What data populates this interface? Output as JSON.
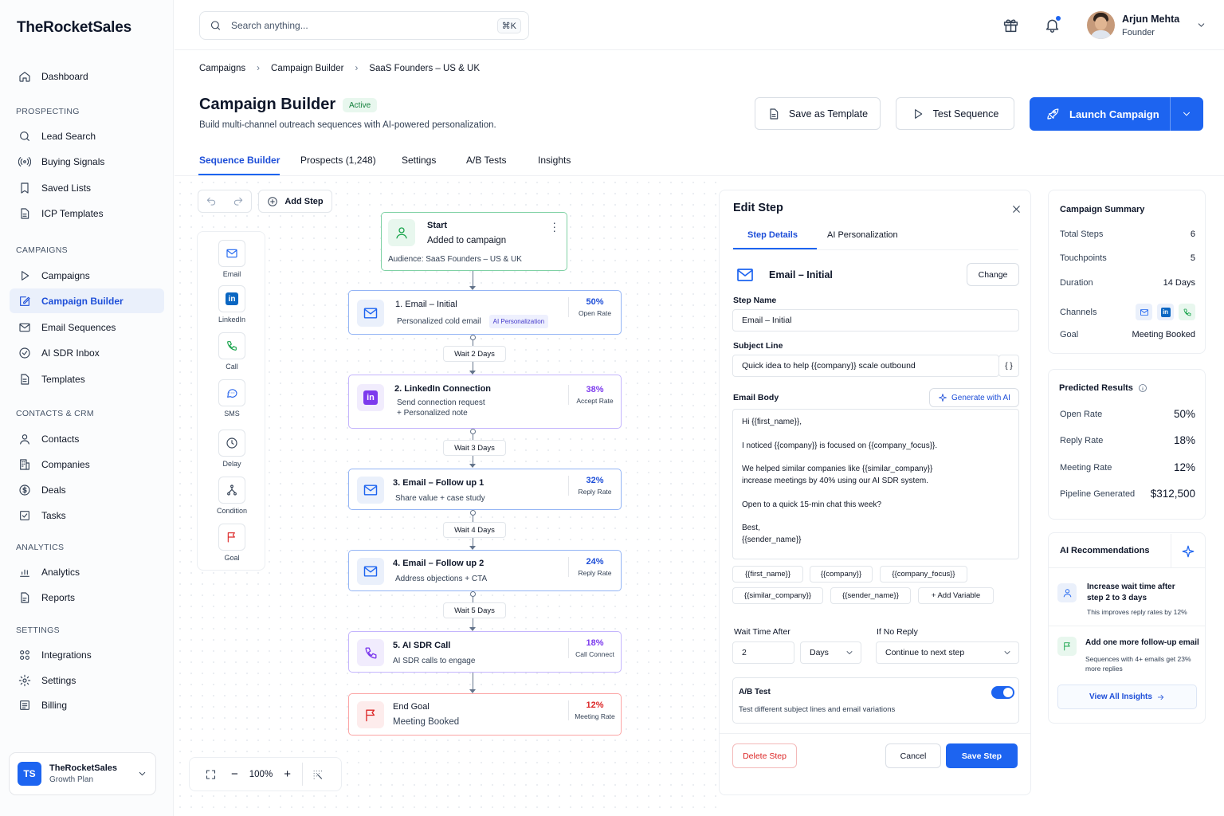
{
  "brand": "TheRocketSales",
  "sidebar": {
    "dashboard": "Dashboard",
    "sec_prospecting": "PROSPECTING",
    "lead_search": "Lead Search",
    "buying_signals": "Buying Signals",
    "saved_lists": "Saved Lists",
    "icp_templates": "ICP Templates",
    "sec_campaigns": "CAMPAIGNS",
    "campaigns": "Campaigns",
    "campaign_builder": "Campaign Builder",
    "email_sequences": "Email Sequences",
    "ai_sdr_inbox": "AI SDR Inbox",
    "templates": "Templates",
    "sec_contacts": "CONTACTS & CRM",
    "contacts": "Contacts",
    "companies": "Companies",
    "deals": "Deals",
    "tasks": "Tasks",
    "sec_analytics": "ANALYTICS",
    "analytics": "Analytics",
    "reports": "Reports",
    "sec_settings": "SETTINGS",
    "integrations": "Integrations",
    "settings": "Settings",
    "billing": "Billing",
    "workspace": {
      "initials": "TS",
      "name": "TheRocketSales",
      "plan": "Growth Plan"
    }
  },
  "topbar": {
    "search_placeholder": "Search anything...",
    "shortcut": "⌘K",
    "user_name": "Arjun Mehta",
    "user_role": "Founder"
  },
  "breadcrumb": [
    "Campaigns",
    "Campaign Builder",
    "SaaS Founders – US & UK"
  ],
  "header": {
    "title": "Campaign Builder",
    "status": "Active",
    "subtitle": "Build multi-channel outreach sequences with AI-powered personalization.",
    "save_template": "Save as Template",
    "test_sequence": "Test Sequence",
    "launch": "Launch Campaign"
  },
  "tabs": [
    "Sequence Builder",
    "Prospects (1,248)",
    "Settings",
    "A/B Tests",
    "Insights"
  ],
  "builder": {
    "add_step": "Add Step",
    "palette": [
      "Email",
      "LinkedIn",
      "Call",
      "SMS",
      "Delay",
      "Condition",
      "Goal"
    ],
    "start": {
      "title": "Start",
      "subtitle": "Added to campaign",
      "audience": "Audience: SaaS Founders – US & UK"
    },
    "steps": [
      {
        "title": "1. Email – Initial",
        "line1": "Personalized cold email",
        "tag": "AI Personalization",
        "pct": "50%",
        "stat": "Open Rate"
      },
      {
        "title": "2. LinkedIn Connection",
        "line1": "Send connection request",
        "line2": "+ Personalized note",
        "pct": "38%",
        "stat": "Accept Rate"
      },
      {
        "title": "3. Email – Follow up 1",
        "line1": "Share value + case study",
        "pct": "32%",
        "stat": "Reply Rate"
      },
      {
        "title": "4. Email – Follow up 2",
        "line1": "Address objections + CTA",
        "pct": "24%",
        "stat": "Reply Rate"
      },
      {
        "title": "5. AI SDR Call",
        "line1": "AI SDR calls to engage",
        "pct": "18%",
        "stat": "Call Connect"
      },
      {
        "title": "End Goal",
        "line1": "Meeting Booked",
        "pct": "12%",
        "stat": "Meeting Rate"
      }
    ],
    "waits": [
      "Wait 2 Days",
      "Wait 3 Days",
      "Wait 4 Days",
      "Wait 5 Days"
    ],
    "zoom": "100%"
  },
  "edit": {
    "title": "Edit Step",
    "tab_details": "Step Details",
    "tab_ai": "AI Personalization",
    "step_type": "Email – Initial",
    "change": "Change",
    "step_name_label": "Step Name",
    "step_name": "Email – Initial",
    "subject_label": "Subject Line",
    "subject": "Quick idea to help {{company}} scale outbound",
    "body_label": "Email Body",
    "generate": "Generate with AI",
    "body": [
      "Hi {{first_name}},",
      "I noticed {{company}} is focused on {{company_focus}}.",
      "We helped similar companies like {{similar_company}}",
      "increase meetings by 40% using our AI SDR system.",
      "Open to a quick 15-min chat this week?",
      "Best,",
      "{{sender_name}}"
    ],
    "vars": [
      "{{first_name}}",
      "{{company}}",
      "{{company_focus}}",
      "{{similar_company}}",
      "{{sender_name}}",
      "+ Add Variable"
    ],
    "wait_label": "Wait Time After",
    "wait_value": "2",
    "wait_unit": "Days",
    "noreply_label": "If No Reply",
    "noreply_value": "Continue to next step",
    "ab_title": "A/B Test",
    "ab_desc": "Test different subject lines and email variations",
    "ab_enabled": true,
    "delete": "Delete Step",
    "cancel": "Cancel",
    "save": "Save Step"
  },
  "summary": {
    "title": "Campaign Summary",
    "rows": [
      {
        "k": "Total Steps",
        "v": "6"
      },
      {
        "k": "Touchpoints",
        "v": "5"
      },
      {
        "k": "Duration",
        "v": "14 Days"
      },
      {
        "k": "Channels",
        "v": ""
      },
      {
        "k": "Goal",
        "v": "Meeting Booked"
      }
    ]
  },
  "predicted": {
    "title": "Predicted Results",
    "rows": [
      {
        "k": "Open Rate",
        "v": "50%"
      },
      {
        "k": "Reply Rate",
        "v": "18%"
      },
      {
        "k": "Meeting Rate",
        "v": "12%"
      },
      {
        "k": "Pipeline Generated",
        "v": "$312,500"
      }
    ]
  },
  "recs": {
    "title": "AI Recommendations",
    "items": [
      {
        "title": "Increase wait time after step 2 to 3 days",
        "desc": "This improves reply rates by 12%"
      },
      {
        "title": "Add one more follow-up email",
        "desc": "Sequences with 4+ emails get 23% more replies"
      }
    ],
    "view_all": "View All Insights"
  },
  "colors": {
    "primary": "#1d64f0",
    "linkedin": "#0a66c2",
    "call": "#16a34a",
    "purple": "#7c3aed",
    "goal": "#dc2626"
  }
}
